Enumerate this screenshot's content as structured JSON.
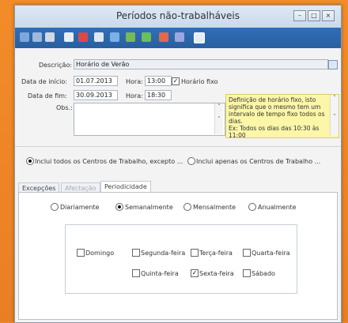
{
  "window": {
    "title": "Períodos não-trabalháveis"
  },
  "form": {
    "descricao_label": "Descrição:",
    "descricao_value": "Horário de Verão",
    "inicio_label": "Data de início:",
    "inicio_value": "01.07.2013",
    "fim_label": "Data de fim:",
    "fim_value": "30.09.2013",
    "hora_label1": "Hora:",
    "hora_value1": "13:00",
    "hora_label2": "Hora:",
    "hora_value2": "18:30",
    "horario_fixo_label": "Horário fixo",
    "obs_label": "Obs.:",
    "note_text": "Definição de horário fixo, isto significa que o mesmo tem um intervalo de tempo fixo todos os dias.\nEx: Todos os dias das 10:30 às 11:00"
  },
  "centros": {
    "opt1": "Inclui todos os Centros de Trabalho, excepto ...",
    "opt2": "Inclui apenas os Centros de Trabalho ..."
  },
  "tabs": {
    "t1": "Excepções",
    "t2": "Afectação",
    "t3": "Periodicidade"
  },
  "periodicidade": {
    "diariamente": "Diariamente",
    "semanalmente": "Semanalmente",
    "mensalmente": "Mensalmente",
    "anualmente": "Anualmente"
  },
  "dias": {
    "domingo": "Domingo",
    "segunda": "Segunda-feira",
    "terca": "Terça-feira",
    "quarta": "Quarta-feira",
    "quinta": "Quinta-feira",
    "sexta": "Sexta-feira",
    "sabado": "Sábado"
  },
  "colors": {
    "toolbar": "#2f6fb8",
    "note": "#fbf6a8",
    "background": "#f28c28"
  }
}
